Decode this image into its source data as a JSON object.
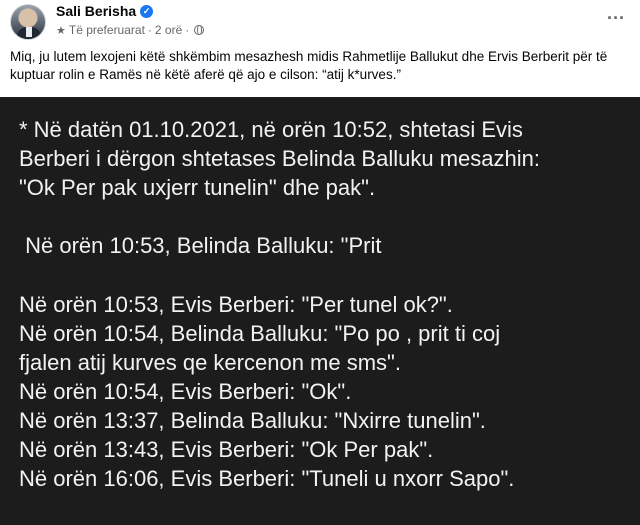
{
  "post": {
    "author": "Sali Berisha",
    "audience": "Të preferuarat",
    "time": "2 orë",
    "caption": "Miq, ju lutem lexojeni këtë shkëmbim mesazhesh midis Rahmetlije Ballukut dhe Ervis Berberit për të kuptuar rolin e Ramës në këtë aferë që ajo e cilson: “atij k*urves.”"
  },
  "icons": {
    "verified": "verified-badge-icon",
    "favorites": "star-icon",
    "privacy": "globe-icon",
    "more": "more-options-icon"
  },
  "colors": {
    "panel_background": "#1c1c1c",
    "panel_text": "#f2f2f2",
    "verified": "#1877f2",
    "meta_text": "#65676b"
  },
  "messages": [
    "* Në datën 01.10.2021, në orën 10:52, shtetasi Evis",
    "Berberi i dërgon shtetases Belinda Balluku mesazhin:",
    "\"Ok Per pak uxjerr tunelin\" dhe pak\".",
    " Në orën 10:53, Belinda Balluku: \"Prit",
    "Në orën 10:53, Evis Berberi: \"Per tunel ok?\".",
    "Në orën 10:54, Belinda Balluku: \"Po po , prit ti coj",
    "fjalen atij kurves qe kercenon me sms\".",
    "Në orën 10:54, Evis Berberi: \"Ok\".",
    "Në orën 13:37, Belinda Balluku: \"Nxirre tunelin\".",
    "Në orën 13:43, Evis Berberi: \"Ok Per pak\".",
    "Në orën 16:06, Evis Berberi: \"Tuneli u nxorr Sapo\"."
  ]
}
